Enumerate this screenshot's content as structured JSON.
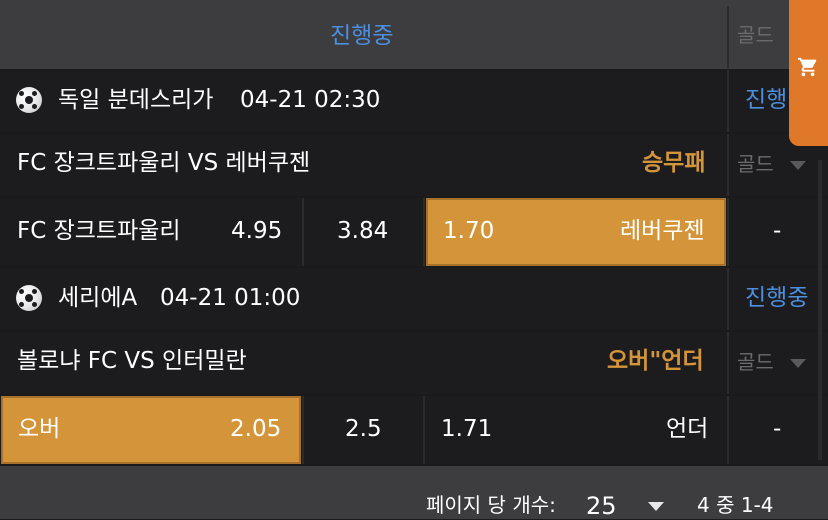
{
  "header": {
    "title": "진행중",
    "gold_label": "골드"
  },
  "cart": {
    "icon": "shopping-cart-icon"
  },
  "match1": {
    "league": "독일 분데스리가",
    "datetime": "04-21 02:30",
    "status": "진행",
    "teams": "FC 장크트파울리 VS 레버쿠젠",
    "market": "승무패",
    "gold": "골드",
    "home": "FC 장크트파울리",
    "home_odds": "4.95",
    "draw_odds": "3.84",
    "away_odds": "1.70",
    "away": "레버쿠젠",
    "extra": "-"
  },
  "match2": {
    "league": "세리에A",
    "datetime": "04-21 01:00",
    "status": "진행중",
    "teams": "볼로냐 FC VS 인터밀란",
    "market": "오버\"언더",
    "gold": "골드",
    "over_label": "오버",
    "over_odds": "2.05",
    "line": "2.5",
    "under_odds": "1.71",
    "under_label": "언더",
    "extra": "-"
  },
  "pagination": {
    "per_page_label": "페이지 당 개수:",
    "per_page_value": "25",
    "range": "4 중 1-4"
  },
  "colors": {
    "accent": "#d4953a",
    "blue": "#4c8fe0",
    "cart": "#e0782a"
  }
}
